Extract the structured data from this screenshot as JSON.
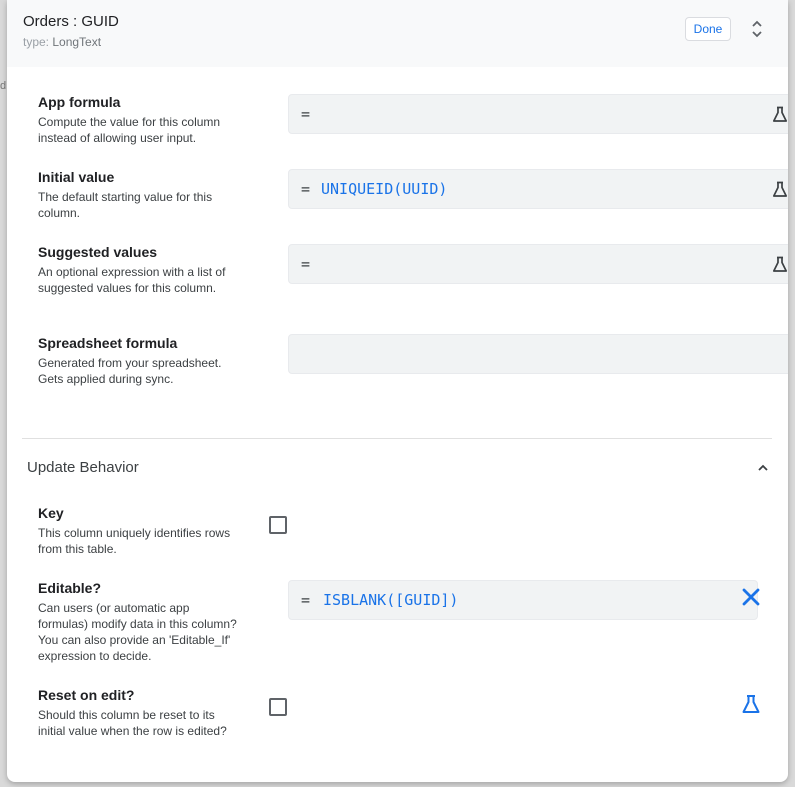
{
  "background": {
    "hint": "d"
  },
  "header": {
    "title": "Orders : GUID",
    "type_label": "type:",
    "type_value": "LongText",
    "done_label": "Done"
  },
  "rows": [
    {
      "label": "App formula",
      "desc": "Compute the value for this column instead of allowing user input.",
      "eq": "=",
      "expr": ""
    },
    {
      "label": "Initial value",
      "desc": "The default starting value for this column.",
      "eq": "=",
      "expr": "UNIQUEID(UUID)"
    },
    {
      "label": "Suggested values",
      "desc": "An optional expression with a list of suggested values for this column.",
      "eq": "=",
      "expr": ""
    },
    {
      "label": "Spreadsheet formula",
      "desc": "Generated from your spreadsheet. Gets applied during sync.",
      "eq": "",
      "expr": ""
    }
  ],
  "update_behavior": {
    "title": "Update Behavior",
    "key": {
      "label": "Key",
      "desc": "This column uniquely identifies rows from this table.",
      "checked": false
    },
    "editable": {
      "label": "Editable?",
      "desc": "Can users (or automatic app formulas) modify data in this column? You can also provide an 'Editable_If' expression to decide.",
      "eq": "=",
      "expr": "ISBLANK([GUID])"
    },
    "reset": {
      "label": "Reset on edit?",
      "desc": "Should this column be reset to its initial value when the row is edited?",
      "checked": false
    }
  },
  "icons": {
    "flask": "flask-icon",
    "close": "close-icon",
    "chevron_up": "chevron-up-icon",
    "unfold": "unfold-icon"
  },
  "colors": {
    "accent": "#1a73e8",
    "field_bg": "#f1f3f4",
    "header_bg": "#f8f9fa"
  }
}
